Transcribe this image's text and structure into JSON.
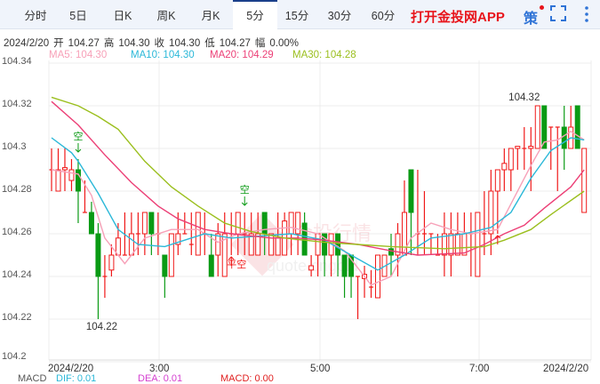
{
  "tabs": [
    "分时",
    "5日",
    "日K",
    "周K",
    "月K",
    "5分",
    "15分",
    "30分",
    "60分"
  ],
  "active_tab": "5分",
  "app_promo": "打开金投网APP",
  "strategy_label": "策",
  "info": {
    "date": "2024/2/20",
    "open_label": "开",
    "open": "104.27",
    "high_label": "高",
    "high": "104.30",
    "close_label": "收",
    "close": "104.30",
    "low_label": "低",
    "low": "104.27",
    "change_label": "幅",
    "change": "0.00%"
  },
  "ma": [
    {
      "label": "MA5: 104.30",
      "color": "#f7a0b8"
    },
    {
      "label": "MA10: 104.30",
      "color": "#2bb8d8"
    },
    {
      "label": "MA20: 104.29",
      "color": "#ec3f76"
    },
    {
      "label": "MA30: 104.28",
      "color": "#9bbf1e"
    }
  ],
  "macd": {
    "title": "MACD",
    "dif": "DIF: 0.01",
    "dea": "DEA: 0.01",
    "macd": "MACD: 0.00"
  },
  "watermark": "金投行情 quote.cngold",
  "chart_data": {
    "type": "candlestick",
    "y_ticks": [
      "104.34",
      "104.32",
      "104.3",
      "104.28",
      "104.26",
      "104.24",
      "104.22",
      "104.2"
    ],
    "ylim": [
      104.2,
      104.34
    ],
    "x_labels": [
      "2024/2/20",
      "3:00",
      "5:00",
      "7:00",
      "2024/2/20"
    ],
    "high_label": "104.32",
    "low_label": "104.22",
    "up_color": "#f01818",
    "down_color": "#0a9a14",
    "candles": [
      [
        104.29,
        104.3,
        104.28,
        104.29
      ],
      [
        104.28,
        104.3,
        104.28,
        104.29
      ],
      [
        104.29,
        104.3,
        104.28,
        104.291
      ],
      [
        104.285,
        104.295,
        104.28,
        104.29
      ],
      [
        104.29,
        104.295,
        104.265,
        104.28
      ],
      [
        104.27,
        104.285,
        104.27,
        104.27
      ],
      [
        104.27,
        104.275,
        104.26,
        104.26
      ],
      [
        104.26,
        104.265,
        104.22,
        104.24
      ],
      [
        104.24,
        104.25,
        104.23,
        104.24
      ],
      [
        104.243,
        104.255,
        104.24,
        104.25
      ],
      [
        104.25,
        104.265,
        104.25,
        104.258
      ],
      [
        104.25,
        104.27,
        104.25,
        104.25
      ],
      [
        104.25,
        104.27,
        104.25,
        104.26
      ],
      [
        104.26,
        104.27,
        104.25,
        104.26
      ],
      [
        104.26,
        104.27,
        104.25,
        104.27
      ],
      [
        104.27,
        104.27,
        104.25,
        104.26
      ],
      [
        104.26,
        104.27,
        104.25,
        104.26
      ],
      [
        104.25,
        104.25,
        104.23,
        104.24
      ],
      [
        104.24,
        104.26,
        104.24,
        104.26
      ],
      [
        104.255,
        104.27,
        104.25,
        104.26
      ],
      [
        104.26,
        104.27,
        104.26,
        104.26
      ],
      [
        104.255,
        104.27,
        104.25,
        104.255
      ],
      [
        104.25,
        104.27,
        104.25,
        104.27
      ],
      [
        104.26,
        104.27,
        104.25,
        104.26
      ],
      [
        104.25,
        104.26,
        104.24,
        104.24
      ],
      [
        104.25,
        104.265,
        104.24,
        104.26
      ],
      [
        104.24,
        104.27,
        104.24,
        104.26
      ],
      [
        104.26,
        104.27,
        104.25,
        104.26
      ],
      [
        104.26,
        104.27,
        104.25,
        104.27
      ],
      [
        104.26,
        104.27,
        104.25,
        104.26
      ],
      [
        104.25,
        104.27,
        104.25,
        104.26
      ],
      [
        104.25,
        104.27,
        104.25,
        104.26
      ],
      [
        104.27,
        104.27,
        104.25,
        104.26
      ],
      [
        104.25,
        104.26,
        104.25,
        104.26
      ],
      [
        104.25,
        104.27,
        104.25,
        104.258
      ],
      [
        104.25,
        104.27,
        104.25,
        104.266
      ],
      [
        104.26,
        104.27,
        104.25,
        104.27
      ],
      [
        104.26,
        104.27,
        104.25,
        104.27
      ],
      [
        104.265,
        104.27,
        104.25,
        104.25
      ],
      [
        104.243,
        104.25,
        104.24,
        104.245
      ],
      [
        104.25,
        104.26,
        104.24,
        104.26
      ],
      [
        104.26,
        104.26,
        104.24,
        104.25
      ],
      [
        104.25,
        104.26,
        104.24,
        104.26
      ],
      [
        104.26,
        104.26,
        104.24,
        104.25
      ],
      [
        104.25,
        104.25,
        104.23,
        104.24
      ],
      [
        104.25,
        104.25,
        104.23,
        104.24
      ],
      [
        104.24,
        104.24,
        104.22,
        104.24
      ],
      [
        104.239,
        104.245,
        104.23,
        104.241
      ],
      [
        104.235,
        104.243,
        104.23,
        104.235
      ],
      [
        104.23,
        104.25,
        104.23,
        104.25
      ],
      [
        104.24,
        104.25,
        104.24,
        104.25
      ],
      [
        104.253,
        104.26,
        104.24,
        104.25
      ],
      [
        104.25,
        104.265,
        104.24,
        104.26
      ],
      [
        104.25,
        104.285,
        104.25,
        104.27
      ],
      [
        104.29,
        104.29,
        104.25,
        104.27
      ],
      [
        104.26,
        104.29,
        104.25,
        104.26
      ],
      [
        104.26,
        104.28,
        104.25,
        104.26
      ],
      [
        104.26,
        104.26,
        104.25,
        104.26
      ],
      [
        104.25,
        104.26,
        104.25,
        104.25
      ],
      [
        104.25,
        104.27,
        104.24,
        104.26
      ],
      [
        104.25,
        104.27,
        104.24,
        104.26
      ],
      [
        104.25,
        104.27,
        104.25,
        104.26
      ],
      [
        104.25,
        104.27,
        104.25,
        104.26
      ],
      [
        104.26,
        104.27,
        104.24,
        104.26
      ],
      [
        104.24,
        104.27,
        104.24,
        104.27
      ],
      [
        104.26,
        104.28,
        104.25,
        104.26
      ],
      [
        104.26,
        104.29,
        104.25,
        104.28
      ],
      [
        104.28,
        104.29,
        104.26,
        104.29
      ],
      [
        104.29,
        104.3,
        104.28,
        104.293
      ],
      [
        104.29,
        104.3,
        104.28,
        104.3
      ],
      [
        104.3,
        104.3,
        104.29,
        104.301
      ],
      [
        104.3,
        104.31,
        104.29,
        104.3
      ],
      [
        104.3,
        104.31,
        104.28,
        104.301
      ],
      [
        104.3,
        104.32,
        104.3,
        104.32
      ],
      [
        104.32,
        104.32,
        104.3,
        104.3
      ],
      [
        104.31,
        104.31,
        104.29,
        104.31
      ],
      [
        104.31,
        104.31,
        104.28,
        104.31
      ],
      [
        104.31,
        104.32,
        104.29,
        104.3
      ],
      [
        104.3,
        104.32,
        104.3,
        104.31
      ],
      [
        104.32,
        104.32,
        104.3,
        104.3
      ],
      [
        104.27,
        104.3,
        104.27,
        104.3
      ]
    ],
    "ma_series": [
      {
        "name": "MA5",
        "color": "#f7a0b8",
        "points": [
          [
            0,
            104.29
          ],
          [
            4,
            104.288
          ],
          [
            6,
            104.278
          ],
          [
            8,
            104.258
          ],
          [
            11,
            104.246
          ],
          [
            14,
            104.258
          ],
          [
            18,
            104.262
          ],
          [
            22,
            104.262
          ],
          [
            25,
            104.256
          ],
          [
            28,
            104.26
          ],
          [
            32,
            104.262
          ],
          [
            36,
            104.263
          ],
          [
            40,
            104.26
          ],
          [
            44,
            104.252
          ],
          [
            48,
            104.236
          ],
          [
            51,
            104.24
          ],
          [
            54,
            104.258
          ],
          [
            57,
            104.265
          ],
          [
            60,
            104.262
          ],
          [
            63,
            104.26
          ],
          [
            67,
            104.262
          ],
          [
            69,
            104.274
          ],
          [
            72,
            104.292
          ],
          [
            74,
            104.303
          ],
          [
            76,
            104.304
          ],
          [
            78,
            104.308
          ],
          [
            80,
            104.304
          ]
        ]
      },
      {
        "name": "MA10",
        "color": "#2bb8d8",
        "points": [
          [
            0,
            104.305
          ],
          [
            3,
            104.298
          ],
          [
            4,
            104.294
          ],
          [
            7,
            104.279
          ],
          [
            10,
            104.262
          ],
          [
            13,
            104.255
          ],
          [
            17,
            104.254
          ],
          [
            19,
            104.256
          ],
          [
            23,
            104.26
          ],
          [
            27,
            104.258
          ],
          [
            36,
            104.26
          ],
          [
            41,
            104.257
          ],
          [
            45,
            104.25
          ],
          [
            49,
            104.243
          ],
          [
            53,
            104.25
          ],
          [
            57,
            104.258
          ],
          [
            62,
            104.26
          ],
          [
            66,
            104.263
          ],
          [
            69,
            104.27
          ],
          [
            72,
            104.286
          ],
          [
            75,
            104.299
          ],
          [
            78,
            104.305
          ],
          [
            80,
            104.304
          ]
        ]
      },
      {
        "name": "MA20",
        "color": "#ec3f76",
        "points": [
          [
            0,
            104.322
          ],
          [
            4,
            104.311
          ],
          [
            8,
            104.297
          ],
          [
            12,
            104.284
          ],
          [
            16,
            104.273
          ],
          [
            19,
            104.267
          ],
          [
            23,
            104.262
          ],
          [
            27,
            104.26
          ],
          [
            33,
            104.258
          ],
          [
            37,
            104.258
          ],
          [
            41,
            104.257
          ],
          [
            46,
            104.255
          ],
          [
            51,
            104.252
          ],
          [
            55,
            104.25
          ],
          [
            62,
            104.251
          ],
          [
            65,
            104.255
          ],
          [
            68,
            104.26
          ],
          [
            71,
            104.264
          ],
          [
            74,
            104.272
          ],
          [
            78,
            104.282
          ],
          [
            80,
            104.29
          ]
        ]
      },
      {
        "name": "MA30",
        "color": "#9bbf1e",
        "points": [
          [
            0,
            104.324
          ],
          [
            4,
            104.32
          ],
          [
            7,
            104.315
          ],
          [
            10,
            104.309
          ],
          [
            14,
            104.294
          ],
          [
            18,
            104.282
          ],
          [
            22,
            104.273
          ],
          [
            26,
            104.265
          ],
          [
            30,
            104.261
          ],
          [
            35,
            104.258
          ],
          [
            41,
            104.256
          ],
          [
            46,
            104.255
          ],
          [
            51,
            104.254
          ],
          [
            59,
            104.253
          ],
          [
            65,
            104.254
          ],
          [
            68,
            104.257
          ],
          [
            72,
            104.262
          ],
          [
            75,
            104.269
          ],
          [
            80,
            104.28
          ]
        ]
      }
    ],
    "signals": [
      {
        "index": 4,
        "text": "空",
        "type": "sell"
      },
      {
        "index": 29,
        "text": "空",
        "type": "sell"
      },
      {
        "index": 27,
        "text": "平空",
        "type": "cover"
      },
      {
        "index": 67,
        "text": "",
        "type": "buy"
      }
    ]
  }
}
